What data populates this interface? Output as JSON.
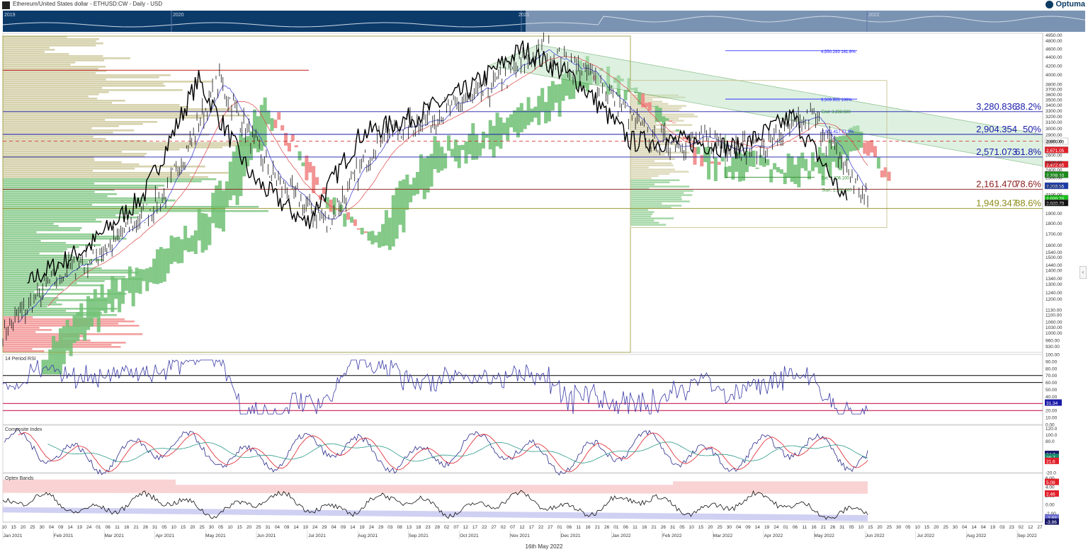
{
  "window": {
    "title": "Ethereum/United States dollar - ETHUSD:CW - Daily - USD",
    "brand": "Optuma"
  },
  "navigator": {
    "years": [
      "2019",
      "2020",
      "2021",
      "2022"
    ]
  },
  "footer": {
    "date": "16th May 2022"
  },
  "colors": {
    "ichimoku_bull": "#6fbf73",
    "ichimoku_bear": "#f08080",
    "volume_profile_high": "#c8c391",
    "fib_blue": "#1a1aff",
    "price": "#111111",
    "rsi": "#3a3aa8"
  },
  "chart_data": [
    {
      "type": "line",
      "title": "",
      "panel": "price",
      "y_axis_ticks": [
        "4950.00",
        "4800.00",
        "4600.00",
        "4400.00",
        "4200.00",
        "4000.00",
        "3800.00",
        "3700.00",
        "3600.00",
        "3500.00",
        "3400.00",
        "3300.00",
        "3200.00",
        "3100.00",
        "3000.00",
        "2900.00",
        "2800.00",
        "2600.00",
        "2500.00",
        "2400.00",
        "2300.00",
        "2200.00",
        "2100.00",
        "2000.00",
        "1900.00",
        "1800.00",
        "1700.00",
        "1600.00",
        "1540.00",
        "1500.00",
        "1440.00",
        "1400.00",
        "1340.00",
        "1300.00",
        "1240.00",
        "1200.00",
        "1130.00",
        "1100.00",
        "1060.00",
        "1030.00",
        "1000.00",
        "960.00",
        "930.00"
      ],
      "ylim": [
        900,
        5000
      ],
      "y_scale": "log",
      "price_labels": [
        {
          "text": "2,800.00",
          "value": 2800,
          "color": "#ffffff",
          "text_color": "#111111"
        },
        {
          "text": "2,671.05",
          "value": 2671,
          "color": "#e0202a",
          "text_color": "#ffffff"
        },
        {
          "text": "2,472.65",
          "value": 2472,
          "color": "#e0202a",
          "text_color": "#ffffff"
        },
        {
          "text": "2,338.10",
          "value": 2338,
          "color": "#1a8a1a",
          "text_color": "#ffffff"
        },
        {
          "text": "2,203.55",
          "value": 2203,
          "color": "#1a3aa8",
          "text_color": "#ffffff"
        },
        {
          "text": "2,020.70",
          "value": 2060,
          "color": "#18c018",
          "text_color": "#ffffff"
        },
        {
          "text": "2,020.70",
          "value": 2010,
          "color": "#111111",
          "text_color": "#ffffff"
        }
      ],
      "fib_levels": [
        {
          "price_text": "3,280.836",
          "pct": "38.2%",
          "value": 3280.836,
          "color": "#1a1aaa"
        },
        {
          "price_text": "2,904.354",
          "pct": "50%",
          "value": 2904.354,
          "color": "#1a1aaa"
        },
        {
          "price_text": "2,571.073",
          "pct": "61.8%",
          "value": 2571.073,
          "color": "#1a1aaa"
        },
        {
          "price_text": "2,161.470",
          "pct": "78.6%",
          "value": 2161.47,
          "color": "#8b1a1a"
        },
        {
          "price_text": "1,949.347",
          "pct": "88.6%",
          "value": 1949.347,
          "color": "#8b8b1a"
        }
      ],
      "fib_extension_labels": [
        {
          "text": "4,550.293   161.8%",
          "value": 4550.293
        },
        {
          "text": "3,509.955   100%",
          "value": 3509.955
        },
        {
          "text": "End: 3,288.500",
          "value": 3288.5
        },
        {
          "text": "Ext: 2,306.100",
          "value": 2306.1
        },
        {
          "text": "Start: 2,160.600",
          "value": 2160.6
        },
        {
          "text": "2,901.417   61.8%",
          "value": 2960
        }
      ],
      "close_series_approx": [
        {
          "x": "Jan 2021",
          "y": 1000
        },
        {
          "x": "Feb 2021",
          "y": 1350
        },
        {
          "x": "Mar 2021",
          "y": 1600
        },
        {
          "x": "Apr 2021",
          "y": 2100
        },
        {
          "x": "May 2021",
          "y": 3900
        },
        {
          "x": "Jun 2021",
          "y": 2300
        },
        {
          "x": "Jul 2021",
          "y": 1800
        },
        {
          "x": "Aug 2021",
          "y": 2900
        },
        {
          "x": "Sep 2021",
          "y": 3200
        },
        {
          "x": "Oct 2021",
          "y": 3700
        },
        {
          "x": "Nov 2021",
          "y": 4600
        },
        {
          "x": "Dec 2021",
          "y": 3900
        },
        {
          "x": "Jan 2022",
          "y": 2800
        },
        {
          "x": "Feb 2022",
          "y": 2800
        },
        {
          "x": "Mar 2022",
          "y": 2700
        },
        {
          "x": "Apr 2022",
          "y": 3200
        },
        {
          "x": "May 2022",
          "y": 2020
        }
      ]
    },
    {
      "type": "line",
      "panel": "rsi",
      "title": "14 Period RSI",
      "y_axis_ticks": [
        "100.00",
        "90.00",
        "80.00",
        "70.00",
        "60.00",
        "50.00",
        "40.00",
        "30.00",
        "20.00",
        "10.00",
        "0.00"
      ],
      "ylim": [
        0,
        100
      ],
      "reference_lines": [
        {
          "value": 70,
          "color": "#000000"
        },
        {
          "value": 60,
          "color": "#000000"
        },
        {
          "value": 30,
          "color": "#c0003a"
        },
        {
          "value": 20,
          "color": "#c0003a"
        }
      ],
      "last_value": {
        "text": "31.34",
        "color": "#1a1aa8"
      }
    },
    {
      "type": "line",
      "panel": "composite",
      "title": "Composite Index",
      "y_axis_ticks": [
        "120.0",
        "100.0",
        "80.0",
        "-20.0"
      ],
      "ylim": [
        -20,
        130
      ],
      "last_values": [
        {
          "text": "34.7",
          "color": "#1a1a6a"
        },
        {
          "text": "29.7",
          "color": "#1a8a6a"
        },
        {
          "text": "21.6",
          "color": "#e0202a"
        }
      ]
    },
    {
      "type": "area",
      "panel": "optex",
      "title": "Optex Bands",
      "y_axis_ticks": [
        "6.00",
        "4.00",
        "2.00",
        "0.00",
        "-2.00"
      ],
      "ylim": [
        -4,
        7
      ],
      "last_values": [
        {
          "text": "5.08",
          "color": "#e0202a"
        },
        {
          "text": "2.46",
          "color": "#e0202a"
        },
        {
          "text": "-2.93",
          "color": "#6f6fd0"
        },
        {
          "text": "-3.86",
          "color": "#1a1a6a"
        }
      ]
    }
  ],
  "x_axis": {
    "day_ticks": [
      "10",
      "15",
      "20",
      "25",
      "30",
      "04",
      "09",
      "14",
      "19",
      "24",
      "01",
      "06",
      "11",
      "16",
      "21",
      "26",
      "31",
      "05",
      "10",
      "15",
      "20",
      "25",
      "30",
      "05",
      "10",
      "15",
      "20",
      "25",
      "31",
      "04",
      "09",
      "14",
      "19",
      "24",
      "29",
      "04",
      "09",
      "14",
      "19",
      "24",
      "29",
      "03",
      "08",
      "13",
      "18",
      "23",
      "28",
      "02",
      "07",
      "12",
      "17",
      "22",
      "27",
      "02",
      "07",
      "12",
      "17",
      "22",
      "27",
      "01",
      "06",
      "11",
      "16",
      "21",
      "26",
      "01",
      "06",
      "11",
      "16",
      "21",
      "26",
      "31",
      "05",
      "10",
      "15",
      "20",
      "25",
      "30",
      "04",
      "09",
      "14",
      "19",
      "24",
      "01",
      "06",
      "11",
      "16",
      "21",
      "26",
      "31",
      "05",
      "10",
      "15",
      "20",
      "25",
      "30",
      "05",
      "10",
      "15",
      "20",
      "25",
      "30",
      "04",
      "14",
      "04",
      "19",
      "03",
      "23",
      "02",
      "12",
      "27"
    ],
    "months": [
      "Jan 2021",
      "Feb 2021",
      "Mar 2021",
      "Apr 2021",
      "May 2021",
      "Jun 2021",
      "Jul 2021",
      "Aug 2021",
      "Sep 2021",
      "Oct 2021",
      "Nov 2021",
      "Dec 2021",
      "Jan 2022",
      "Feb 2022",
      "Mar 2022",
      "Apr 2022",
      "May 2022",
      "Jun 2022",
      "Jul 2022",
      "Aug 2022",
      "Sep 2022"
    ]
  }
}
